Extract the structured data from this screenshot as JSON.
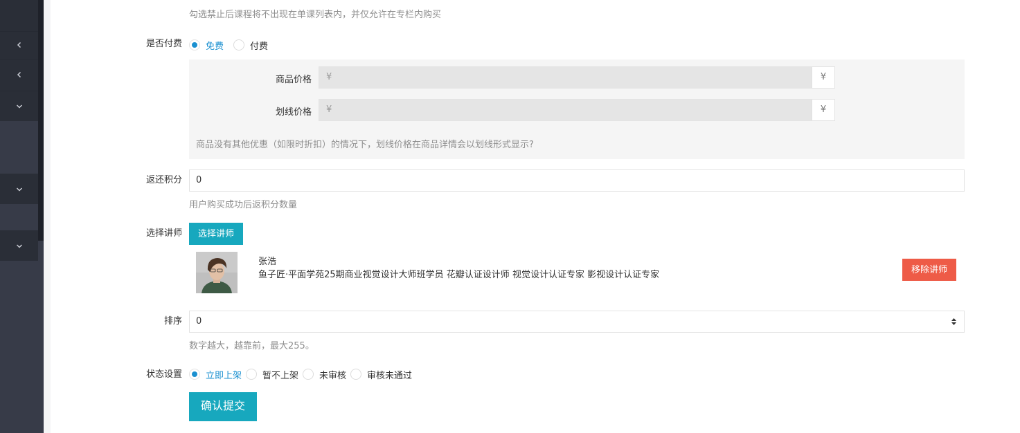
{
  "course_visibility_hint": "勾选禁止后课程将不出现在单课列表内，并仅允许在专栏内购买",
  "payment": {
    "label": "是否付费",
    "options": [
      {
        "label": "免费",
        "checked": true
      },
      {
        "label": "付费",
        "checked": false
      }
    ],
    "price_label": "商品价格",
    "price_prefix": "¥",
    "price_suffix": "¥",
    "strike_label": "划线价格",
    "strike_prefix": "¥",
    "strike_suffix": "¥",
    "strike_hint": "商品没有其他优惠（如限时折扣）的情况下，划线价格在商品详情会以划线形式显示?"
  },
  "points": {
    "label": "返还积分",
    "value": "0",
    "hint": "用户购买成功后返积分数量"
  },
  "teacher": {
    "label": "选择讲师",
    "select_button": "选择讲师",
    "name": "张浩",
    "description": "鱼子匠·平面学苑25期商业视觉设计大师班学员 花瓣认证设计师 视觉设计认证专家 影视设计认证专家",
    "remove_button": "移除讲师"
  },
  "sort": {
    "label": "排序",
    "value": "0",
    "hint": "数字越大，越靠前，最大255。"
  },
  "status": {
    "label": "状态设置",
    "options": [
      {
        "label": "立即上架",
        "checked": true
      },
      {
        "label": "暂不上架",
        "checked": false
      },
      {
        "label": "未审核",
        "checked": false
      },
      {
        "label": "审核未通过",
        "checked": false
      }
    ]
  },
  "submit_button": "确认提交",
  "sidebar": {
    "icons": [
      "chevron-left-icon",
      "chevron-left-icon",
      "chevron-down-icon",
      "chevron-down-icon",
      "chevron-down-icon"
    ]
  },
  "colors": {
    "accent": "#17a8be",
    "radio_active": "#1a90d0",
    "danger": "#ee5b47",
    "sidebar": "#373b48"
  }
}
